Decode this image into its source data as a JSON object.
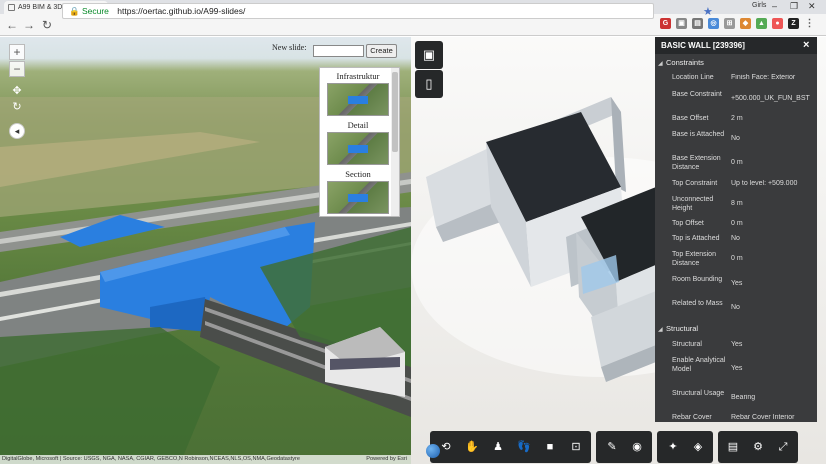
{
  "browser": {
    "tab_title": "A99 BIM & 3D GIS",
    "secure_label": "Secure",
    "url": "https://oertac.github.io/A99-slides/",
    "user": "Girls"
  },
  "map": {
    "zoom_in": "+",
    "zoom_out": "−",
    "new_slide_label": "New slide:",
    "new_slide_value": "",
    "create_label": "Create",
    "slides": [
      {
        "title": "Infrastruktur"
      },
      {
        "title": "Detail"
      },
      {
        "title": "Section"
      }
    ],
    "credits": "DigitalGlobe, Microsoft | Source: USGS, NGA, NASA, CGIAR, GEBCO,N Robinson,NCEAS,NLS,OS,NMA,Geodatastyre",
    "powered_by": "Powered by Esri"
  },
  "properties": {
    "title": "BASIC WALL [239396]",
    "close": "×",
    "groups": [
      {
        "name": "Constraints",
        "rows": [
          {
            "key": "Location Line",
            "value": "Finish Face: Exterior"
          },
          {
            "key": "Base Constraint",
            "value": "+500.000_UK_FUN_BST"
          },
          {
            "key": "Base Offset",
            "value": "2 m"
          },
          {
            "key": "Base is Attached",
            "value": "No"
          },
          {
            "key": "Base Extension Distance",
            "value": "0 m"
          },
          {
            "key": "Top Constraint",
            "value": "Up to level: +509.000"
          },
          {
            "key": "Unconnected Height",
            "value": "8 m"
          },
          {
            "key": "Top Offset",
            "value": "0 m"
          },
          {
            "key": "Top is Attached",
            "value": "No"
          },
          {
            "key": "Top Extension Distance",
            "value": "0 m"
          },
          {
            "key": "Room Bounding",
            "value": "Yes"
          },
          {
            "key": "Related to Mass",
            "value": "No"
          }
        ]
      },
      {
        "name": "Structural",
        "rows": [
          {
            "key": "Structural",
            "value": "Yes"
          },
          {
            "key": "Enable Analytical Model",
            "value": "Yes"
          },
          {
            "key": "Structural Usage",
            "value": "Bearing"
          },
          {
            "key": "Rebar Cover",
            "value": "Rebar Cover Interior"
          }
        ]
      }
    ]
  },
  "colors": {
    "accent_blue": "#2a7fe0",
    "panel_bg": "#3a3b3d",
    "toolbar_bg": "#262829"
  }
}
